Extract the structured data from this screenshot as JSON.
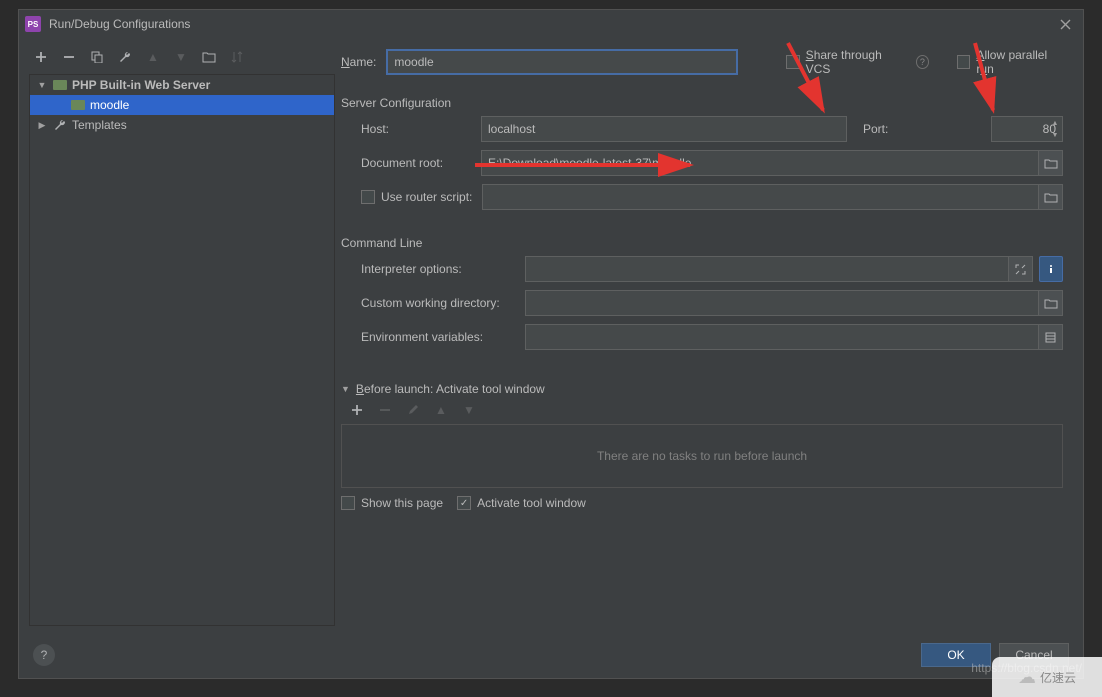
{
  "title": "Run/Debug Configurations",
  "tree": {
    "root": "PHP Built-in Web Server",
    "child": "moodle",
    "templates": "Templates"
  },
  "form": {
    "name_label_prefix": "N",
    "name_label_rest": "ame:",
    "name_value": "moodle",
    "share_prefix": "S",
    "share_rest": "hare through VCS",
    "allow_prefix": "A",
    "allow_rest": "llow parallel r",
    "allow_u": "u",
    "allow_end": "n"
  },
  "server": {
    "section": "Server Configuration",
    "host_label": "Host:",
    "host_value": "localhost",
    "port_label": "Port:",
    "port_value": "80",
    "doc_label": "Document root:",
    "doc_value": "E:\\Download\\moodle-latest-37\\moodle",
    "router_label": "Use router script:"
  },
  "cmd": {
    "section": "Command Line",
    "interp_label": "Interpreter options:",
    "cwd_label": "Custom working directory:",
    "env_label": "Environment variables:"
  },
  "before": {
    "header_prefix": "B",
    "header_rest": "efore launch: Activate tool window",
    "empty": "There are no tasks to run before launch",
    "show_page": "Show this page",
    "activate": "Activate tool window"
  },
  "footer": {
    "ok": "OK",
    "cancel": "Cancel"
  },
  "watermark": {
    "text": "亿速云",
    "url": "https://blog.csdn.net/"
  }
}
